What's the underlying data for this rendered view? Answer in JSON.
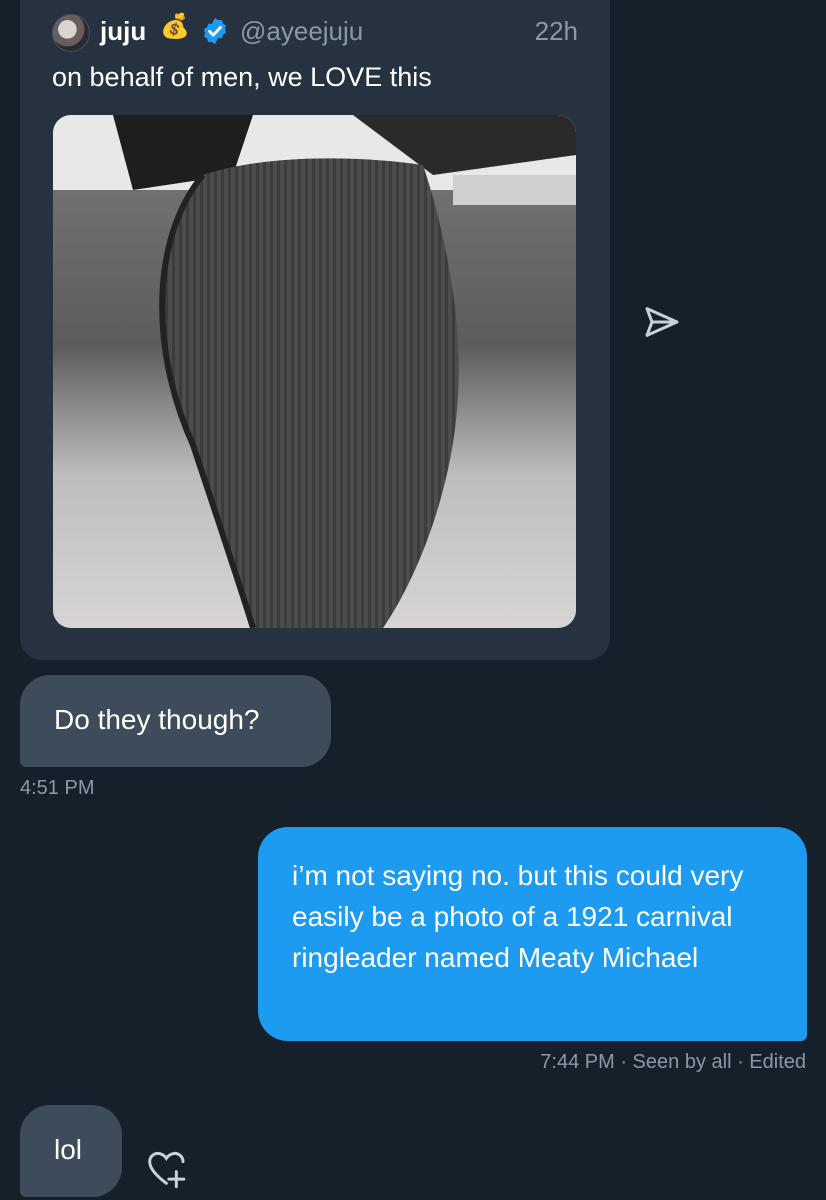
{
  "quoted_post": {
    "name": "juju",
    "name_emoji": "💰",
    "verified": true,
    "handle": "@ayeejuju",
    "time": "22h",
    "text": "on behalf of men, we LOVE this"
  },
  "messages": [
    {
      "direction": "received",
      "text": "Do they though?",
      "timestamp": "4:51 PM"
    },
    {
      "direction": "sent",
      "text": "i’m not saying no. but this could very easily be a photo of a 1921 carnival ringleader named Meaty Michael",
      "timestamp": "7:44 PM",
      "status": " · Seen by all · Edited"
    },
    {
      "direction": "received",
      "text": "lol"
    }
  ],
  "icons": {
    "share": "share-arrow-icon",
    "react": "heart-plus-icon",
    "verified": "verified-badge-icon",
    "avatar": "avatar"
  },
  "colors": {
    "background": "#16202a",
    "card": "#263240",
    "received_bubble": "#3e4b5a",
    "sent_bubble": "#1d9bf0",
    "muted_text": "#8b98a5",
    "verified_blue": "#1d9bf0"
  }
}
